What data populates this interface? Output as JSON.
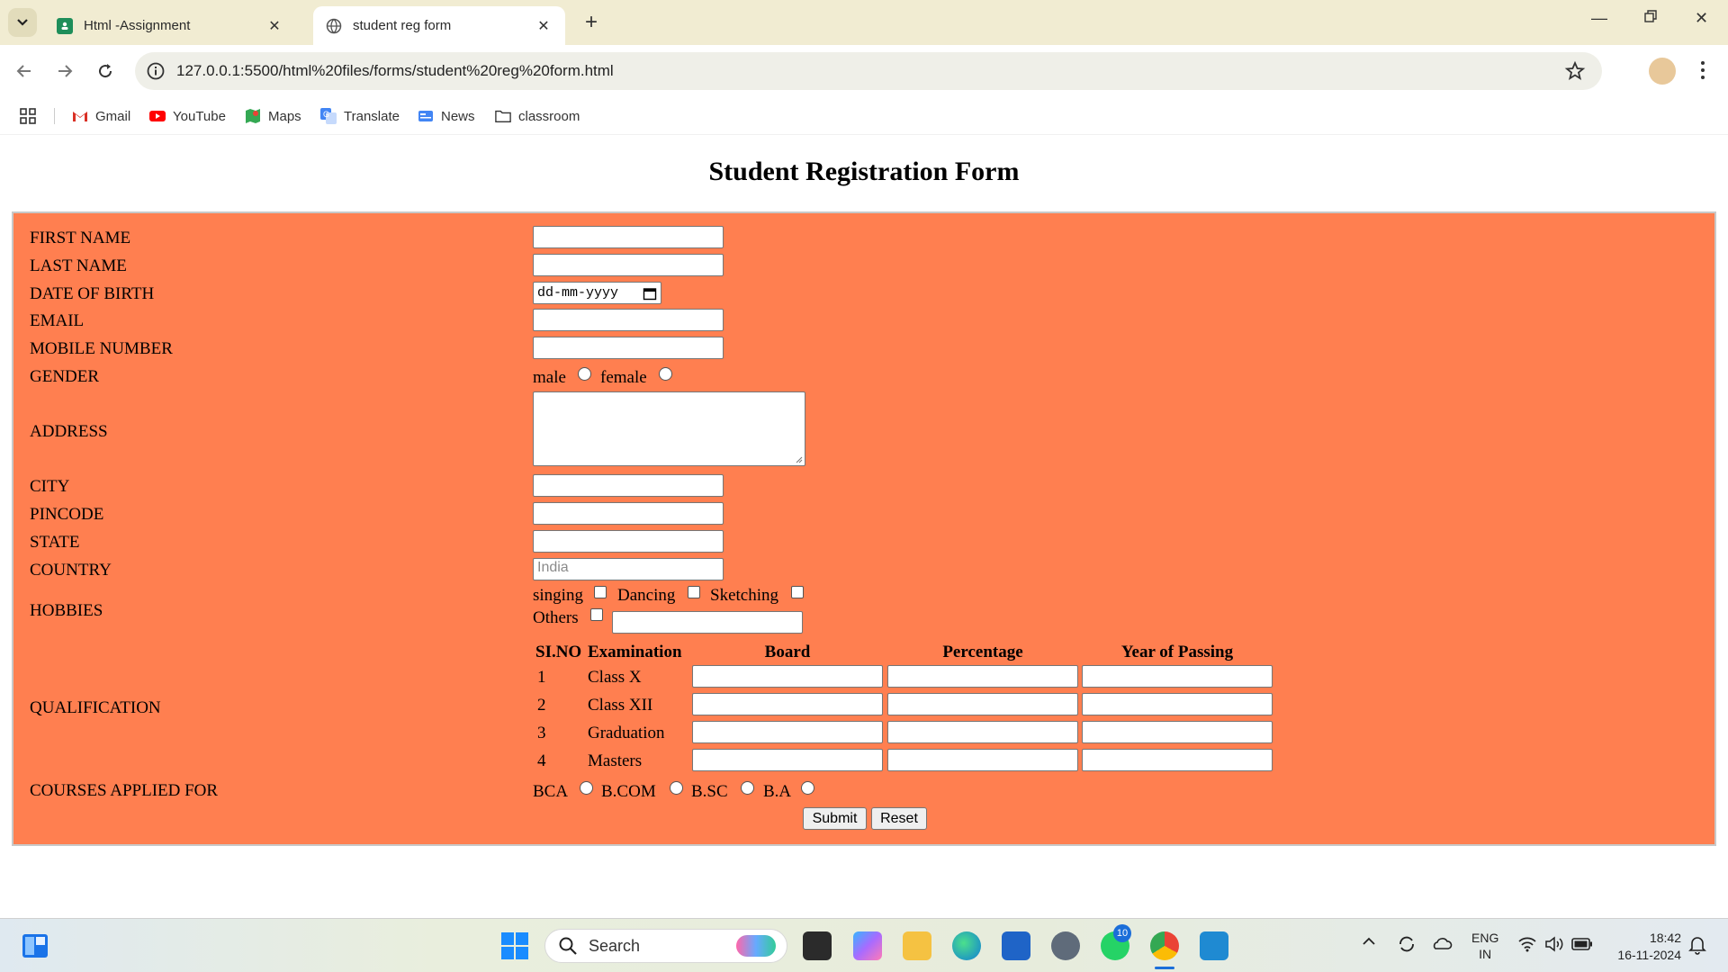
{
  "browser": {
    "tabs": [
      {
        "title": "Html -Assignment",
        "active": false
      },
      {
        "title": "student reg form",
        "active": true
      }
    ],
    "new_tab": "+",
    "url": "127.0.0.1:5500/html%20files/forms/student%20reg%20form.html",
    "bookmarks": [
      {
        "label": "Gmail",
        "icon": "gmail-icon"
      },
      {
        "label": "YouTube",
        "icon": "youtube-icon"
      },
      {
        "label": "Maps",
        "icon": "maps-icon"
      },
      {
        "label": "Translate",
        "icon": "translate-icon"
      },
      {
        "label": "News",
        "icon": "news-icon"
      },
      {
        "label": "classroom",
        "icon": "folder-icon"
      }
    ]
  },
  "page": {
    "title": "Student Registration Form",
    "labels": {
      "first_name": "FIRST NAME",
      "last_name": "LAST NAME",
      "dob": "DATE OF BIRTH",
      "email": "EMAIL",
      "mobile": "MOBILE NUMBER",
      "gender": "GENDER",
      "address": "ADDRESS",
      "city": "CITY",
      "pincode": "PINCODE",
      "state": "STATE",
      "country": "COUNTRY",
      "hobbies": "HOBBIES",
      "qualification": "QUALIFICATION",
      "courses": "COURSES APPLIED FOR"
    },
    "dob_placeholder": "dd-mm-yyyy",
    "country_placeholder": "India",
    "gender_options": [
      "male",
      "female"
    ],
    "hobbies": [
      "singing",
      "Dancing",
      "Sketching",
      "Others"
    ],
    "qualification_table": {
      "headers": [
        "SI.NO",
        "Examination",
        "Board",
        "Percentage",
        "Year of Passing"
      ],
      "rows": [
        {
          "sno": "1",
          "exam": "Class X"
        },
        {
          "sno": "2",
          "exam": "Class XII"
        },
        {
          "sno": "3",
          "exam": "Graduation"
        },
        {
          "sno": "4",
          "exam": "Masters"
        }
      ]
    },
    "courses": [
      "BCA",
      "B.COM",
      "B.SC",
      "B.A"
    ],
    "buttons": {
      "submit": "Submit",
      "reset": "Reset"
    }
  },
  "taskbar": {
    "search_placeholder": "Search",
    "whatsapp_badge": "10",
    "language": "ENG",
    "region": "IN",
    "time": "18:42",
    "date": "16-11-2024"
  }
}
